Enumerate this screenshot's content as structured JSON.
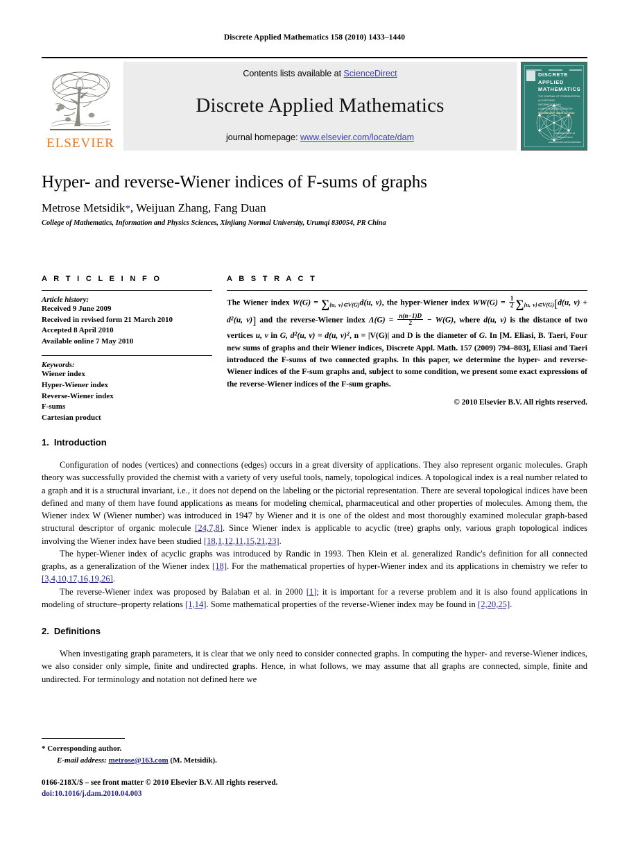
{
  "running_head": "Discrete Applied Mathematics 158 (2010) 1433–1440",
  "masthead": {
    "contents_prefix": "Contents lists available at ",
    "sciencedirect": "ScienceDirect",
    "journal_title": "Discrete Applied Mathematics",
    "homepage_prefix": "journal homepage: ",
    "homepage_url": "www.elsevier.com/locate/dam",
    "publisher_wordmark": "ELSEVIER",
    "publisher_color": "#E87722",
    "link_color": "#3b3bbb"
  },
  "cover": {
    "title_line1": "DISCRETE",
    "title_line2": "APPLIED",
    "title_line3": "MATHEMATICS",
    "subtitle": "THE JOURNAL OF COMBINATORIAL ALGORITHMS,",
    "subtitle2": "INFORMATICS AND COMPUTATIONAL SCIENCES",
    "volume_note": "VOLUME 158 · ISSUE 14 · 2010",
    "footer1": "Available online at",
    "footer2": "ScienceDirect",
    "footer3": "www.elsevier.com/locate/dam",
    "background_color": "#2f7d72"
  },
  "article": {
    "title": "Hyper- and reverse-Wiener indices of F-sums of graphs",
    "authors": "Metrose Metsidik",
    "authors_rest": ", Weijuan Zhang, Fang Duan",
    "corresponding_marker": "*",
    "affiliation": "College of Mathematics, Information and Physics Sciences, Xinjiang Normal University, Urumqi 830054, PR China"
  },
  "article_info": {
    "heading": "A R T I C L E   I N F O",
    "history_label": "Article history:",
    "history": [
      "Received 9 June 2009",
      "Received in revised form 21 March 2010",
      "Accepted 8 April 2010",
      "Available online 7 May 2010"
    ],
    "keywords_label": "Keywords:",
    "keywords": [
      "Wiener index",
      "Hyper-Wiener index",
      "Reverse-Wiener index",
      "F-sums",
      "Cartesian product"
    ]
  },
  "abstract": {
    "heading": "A B S T R A C T",
    "t1": "The Wiener index ",
    "m_W": "W",
    "m_WG": "(G)",
    "eq": " = ",
    "sum_sub1": "{u, v}⊂V(G)",
    "d_uv": "d(u, v)",
    "t2": ", the hyper-Wiener index ",
    "m_WW": "WW",
    "t3": " = ",
    "frac1_num": "1",
    "frac1_den": "2",
    "sum_sub2": "{u, v}⊂V(G)",
    "inner1": "d(u, v) + d",
    "inner1_sup": "2",
    "inner2": "(u, v)",
    "t4": " and the reverse-Wiener index ",
    "m_Lambda": "Λ",
    "frac2_num": "n(n−1)D",
    "frac2_den": "2",
    "t5": " − ",
    "t6": ", where ",
    "t7": " is the distance of two vertices ",
    "t8": "u, v",
    "t9": " in ",
    "t10": "G, d",
    "t10_sup": "2",
    "t11": "(u, v) = d(u, v)",
    "t11_sup": "2",
    "t12": ", n = |V(G)| and D is the diameter of ",
    "t13": "G",
    "t14": ". In [M. Eliasi, B. Taeri, Four new sums of graphs and their Wiener indices, Discrete Appl. Math. 157 (2009) 794–803], Eliasi and Taeri introduced the F-sums of two connected graphs. In this paper, we determine the hyper- and reverse-Wiener indices of the F-sum graphs and, subject to some condition, we present some exact expressions of the reverse-Wiener indices of the F-sum graphs.",
    "copyright": "© 2010 Elsevier B.V. All rights reserved."
  },
  "sections": [
    {
      "number": "1.",
      "title": "Introduction"
    },
    {
      "number": "2.",
      "title": "Definitions"
    }
  ],
  "paragraphs": {
    "intro_p1_a": "Configuration of nodes (vertices) and connections (edges) occurs in a great diversity of applications. They also represent organic molecules. Graph theory was successfully provided the chemist with a variety of very useful tools, namely, topological indices. A topological index is a real number related to a graph and it is a structural invariant, i.e., it does not depend on the labeling or the pictorial representation. There are several topological indices have been defined and many of them have found applications as means for modeling chemical, pharmaceutical and other properties of molecules. Among them, the Wiener index W (Wiener number) was introduced in 1947 by Wiener and it is one of the oldest and most thoroughly examined molecular graph-based structural descriptor of organic molecule ",
    "intro_p1_cite1": "[24,7,8]",
    "intro_p1_b": ". Since Wiener index is applicable to acyclic (tree) graphs only, various graph topological indices involving the Wiener index have been studied ",
    "intro_p1_cite2": "[18,1,12,11,15,21,23]",
    "intro_p1_c": ".",
    "intro_p2_a": "The hyper-Wiener index of acyclic graphs was introduced by Randic in 1993. Then Klein et al. generalized Randic's definition for all connected graphs, as a generalization of the Wiener index ",
    "intro_p2_cite1": "[18]",
    "intro_p2_b": ". For the mathematical properties of hyper-Wiener index and its applications in chemistry we refer to ",
    "intro_p2_cite2": "[3,4,10,17,16,19,26]",
    "intro_p2_c": ".",
    "intro_p3_a": "The reverse-Wiener index was proposed by Balaban et al. in 2000 ",
    "intro_p3_cite1": "[1]",
    "intro_p3_b": "; it is important for a reverse problem and it is also found applications in modeling of structure–property relations ",
    "intro_p3_cite2": "[1,14]",
    "intro_p3_c": ". Some mathematical properties of the reverse-Wiener index may be found in ",
    "intro_p3_cite3": "[2,20,25]",
    "intro_p3_d": ".",
    "def_p1": "When investigating graph parameters, it is clear that we only need to consider connected graphs. In computing the hyper- and reverse-Wiener indices, we also consider only simple, finite and undirected graphs. Hence, in what follows, we may assume that all graphs are connected, simple, finite and undirected. For terminology and notation not defined here we"
  },
  "footnotes": {
    "star": "*",
    "corresponding": "Corresponding author.",
    "email_label": "E-mail address:",
    "email": "metrose@163.com",
    "email_suffix": "(M. Metsidik)."
  },
  "imprint": {
    "front_matter": "0166-218X/$ – see front matter © 2010 Elsevier B.V. All rights reserved.",
    "doi": "doi:10.1016/j.dam.2010.04.003"
  }
}
